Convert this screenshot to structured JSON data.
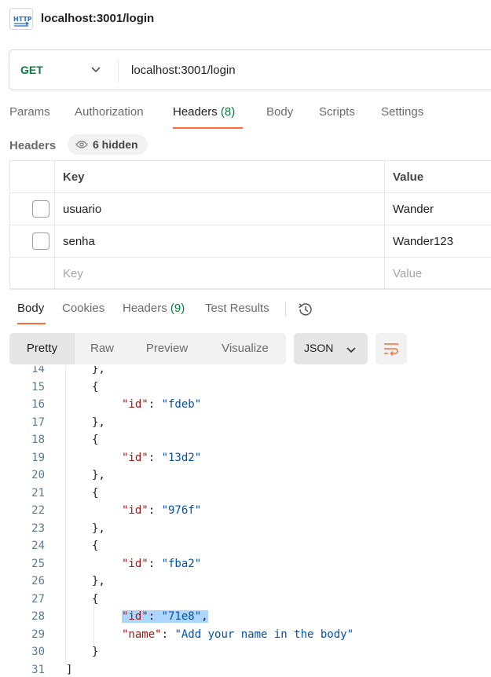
{
  "window": {
    "title": "localhost:3001/login",
    "icon": "http-icon"
  },
  "request": {
    "method": "GET",
    "url": "localhost:3001/login"
  },
  "request_tabs": [
    {
      "label": "Params"
    },
    {
      "label": "Authorization"
    },
    {
      "label": "Headers",
      "count": "(8)",
      "active": true
    },
    {
      "label": "Body"
    },
    {
      "label": "Scripts"
    },
    {
      "label": "Settings"
    }
  ],
  "headers_section": {
    "label": "Headers",
    "hidden_label": "6 hidden",
    "columns": {
      "key": "Key",
      "value": "Value"
    },
    "rows": [
      {
        "key": "usuario",
        "value": "Wander"
      },
      {
        "key": "senha",
        "value": "Wander123"
      }
    ],
    "placeholder": {
      "key": "Key",
      "value": "Value"
    }
  },
  "response_tabs": [
    {
      "label": "Body",
      "active": true
    },
    {
      "label": "Cookies"
    },
    {
      "label": "Headers",
      "count": "(9)"
    },
    {
      "label": "Test Results"
    }
  ],
  "format_tabs": [
    "Pretty",
    "Raw",
    "Preview",
    "Visualize"
  ],
  "format_select": "JSON",
  "code_lines": [
    {
      "n": "14",
      "t": "},"
    },
    {
      "n": "15",
      "t": "{"
    },
    {
      "n": "16",
      "key": "\"id\"",
      "val": "\"fdeb\""
    },
    {
      "n": "17",
      "t": "},"
    },
    {
      "n": "18",
      "t": "{"
    },
    {
      "n": "19",
      "key": "\"id\"",
      "val": "\"13d2\""
    },
    {
      "n": "20",
      "t": "},"
    },
    {
      "n": "21",
      "t": "{"
    },
    {
      "n": "22",
      "key": "\"id\"",
      "val": "\"976f\""
    },
    {
      "n": "23",
      "t": "},"
    },
    {
      "n": "24",
      "t": "{"
    },
    {
      "n": "25",
      "key": "\"id\"",
      "val": "\"fba2\""
    },
    {
      "n": "26",
      "t": "},"
    },
    {
      "n": "27",
      "t": "{"
    },
    {
      "n": "28",
      "key": "\"id\"",
      "val": "\"71e8\"",
      "comma": true,
      "selected": true
    },
    {
      "n": "29",
      "key": "\"name\"",
      "val": "\"Add your name in the body\""
    },
    {
      "n": "30",
      "t": "}"
    },
    {
      "n": "31",
      "t": "]"
    }
  ],
  "colors": {
    "method_get": "#00803c",
    "accent_orange": "#ff6c37",
    "json_key": "#a31515",
    "json_string": "#0451a5",
    "selection": "#add6ff"
  }
}
